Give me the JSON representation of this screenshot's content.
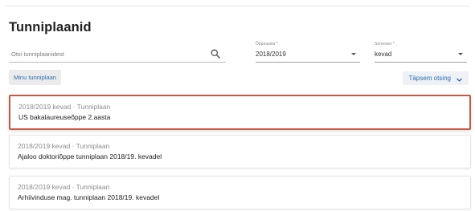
{
  "page": {
    "title": "Tunniplaanid"
  },
  "search": {
    "placeholder": "Otsi tunniplaanidest",
    "icon": "search-icon"
  },
  "filters": {
    "year": {
      "label": "Õppeaasta *",
      "value": "2018/2019"
    },
    "term": {
      "label": "Semester *",
      "value": "kevad"
    }
  },
  "actions": {
    "my_schedule": "Minu tunniplaan",
    "sort": "Täpsem otsing",
    "sort_icon": "chevron-down-icon"
  },
  "schedules": [
    {
      "meta": "2018/2019 kevad · Tunniplaan",
      "title": "US bakalaureuseõppe 2.aasta",
      "selected": true
    },
    {
      "meta": "2018/2019 kevad · Tunniplaan",
      "title": "Ajaloo doktoriõppe tunniplaan 2018/19. kevadel",
      "selected": false
    },
    {
      "meta": "2018/2019 kevad · Tunniplaan",
      "title": "Arhiivinduse mag. tunniplaan 2018/19. kevadel",
      "selected": false
    }
  ],
  "colors": {
    "accent": "#2d6fb5",
    "selected_border": "#c45a43"
  }
}
